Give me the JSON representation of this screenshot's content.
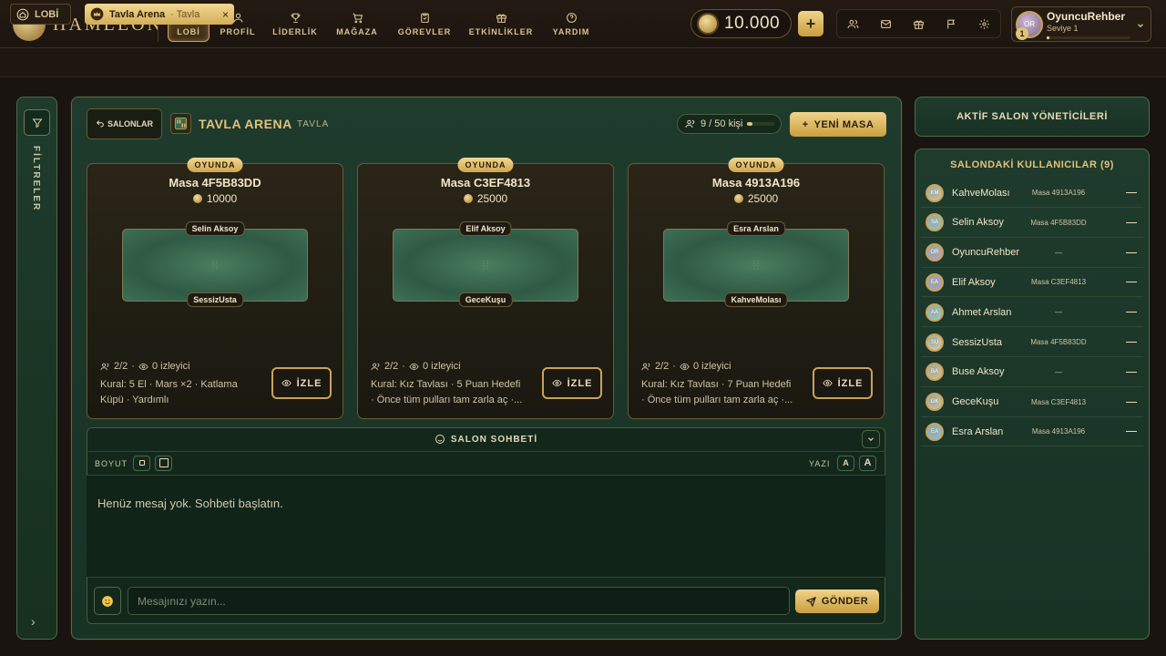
{
  "brand": {
    "name": "HAMLEON"
  },
  "nav": [
    {
      "label": "LOBİ",
      "icon": "home-icon",
      "active": true
    },
    {
      "label": "PROFİL",
      "icon": "user-icon"
    },
    {
      "label": "LİDERLİK",
      "icon": "trophy-icon"
    },
    {
      "label": "MAĞAZA",
      "icon": "cart-icon"
    },
    {
      "label": "GÖREVLER",
      "icon": "clipboard-icon"
    },
    {
      "label": "ETKİNLİKLER",
      "icon": "gift-icon"
    },
    {
      "label": "YARDIM",
      "icon": "help-icon"
    }
  ],
  "wallet": {
    "coins": "10.000",
    "add_label": "+"
  },
  "quick_icons": [
    "friends-icon",
    "mail-icon",
    "gift-icon",
    "flag-icon",
    "settings-icon"
  ],
  "user": {
    "name": "OyuncuRehber",
    "level_text": "Seviye 1",
    "level": "1",
    "initials": "OR",
    "xp_fraction": 0.03
  },
  "breadcrumb": {
    "lobby": "LOBİ",
    "tab_title": "Tavla Arena",
    "tab_sub": "· Tavla",
    "close": "×"
  },
  "filters": {
    "label": "FİLTRELER",
    "expand": "›"
  },
  "arena": {
    "back_label": "SALONLAR",
    "name": "TAVLA ARENA",
    "type": "TAVLA",
    "capacity_text": "9 / 50 kişi",
    "capacity_fraction": 0.18,
    "new_table_label": "YENİ MASA"
  },
  "tables": [
    {
      "status": "OYUNDA",
      "name": "Masa 4F5B83DD",
      "stake": "10000",
      "player_top": "Selin Aksoy",
      "player_bottom": "SessizUsta",
      "players": "2/2",
      "spectators": "0 izleyici",
      "rules": "Kural: 5 El · Mars ×2 · Katlama Küpü · Yardımlı",
      "watch_label": "İZLE"
    },
    {
      "status": "OYUNDA",
      "name": "Masa C3EF4813",
      "stake": "25000",
      "player_top": "Elif Aksoy",
      "player_bottom": "GeceKuşu",
      "players": "2/2",
      "spectators": "0 izleyici",
      "rules": "Kural: Kız Tavlası · 5 Puan Hedefi · Önce tüm pulları tam zarla aç ·...",
      "watch_label": "İZLE"
    },
    {
      "status": "OYUNDA",
      "name": "Masa 4913A196",
      "stake": "25000",
      "player_top": "Esra Arslan",
      "player_bottom": "KahveMolası",
      "players": "2/2",
      "spectators": "0 izleyici",
      "rules": "Kural: Kız Tavlası · 7 Puan Hedefi · Önce tüm pulları tam zarla aç ·...",
      "watch_label": "İZLE"
    }
  ],
  "chat": {
    "title": "SALON SOHBETİ",
    "size_label": "BOYUT",
    "font_label": "YAZI",
    "font_small": "A",
    "font_large": "A",
    "empty_text": "Henüz mesaj yok. Sohbeti başlatın.",
    "placeholder": "Mesajınızı yazın...",
    "send_label": "GÖNDER"
  },
  "moderators": {
    "title": "AKTİF SALON YÖNETİCİLERİ"
  },
  "room_users": {
    "title": "SALONDAKİ KULLANICILAR (9)",
    "items": [
      {
        "name": "KahveMolası",
        "table": "Masa 4913A196",
        "initials": "KM",
        "color": "#d9c79a"
      },
      {
        "name": "Selin Aksoy",
        "table": "Masa 4F5B83DD",
        "initials": "SA",
        "color": "#9cc8c4"
      },
      {
        "name": "OyuncuRehber",
        "table": "—",
        "initials": "OR",
        "color": "#b9a3c4"
      },
      {
        "name": "Elif Aksoy",
        "table": "Masa C3EF4813",
        "initials": "EA",
        "color": "#b4a0d0"
      },
      {
        "name": "Ahmet Arslan",
        "table": "—",
        "initials": "AA",
        "color": "#9ccfd0"
      },
      {
        "name": "SessizUsta",
        "table": "Masa 4F5B83DD",
        "initials": "SU",
        "color": "#e4d6a4"
      },
      {
        "name": "Buse Aksoy",
        "table": "—",
        "initials": "BA",
        "color": "#e3c68c"
      },
      {
        "name": "GeceKuşu",
        "table": "Masa C3EF4813",
        "initials": "GK",
        "color": "#d6c89a"
      },
      {
        "name": "Esra Arslan",
        "table": "Masa 4913A196",
        "initials": "EA",
        "color": "#8cc7dc"
      }
    ]
  }
}
